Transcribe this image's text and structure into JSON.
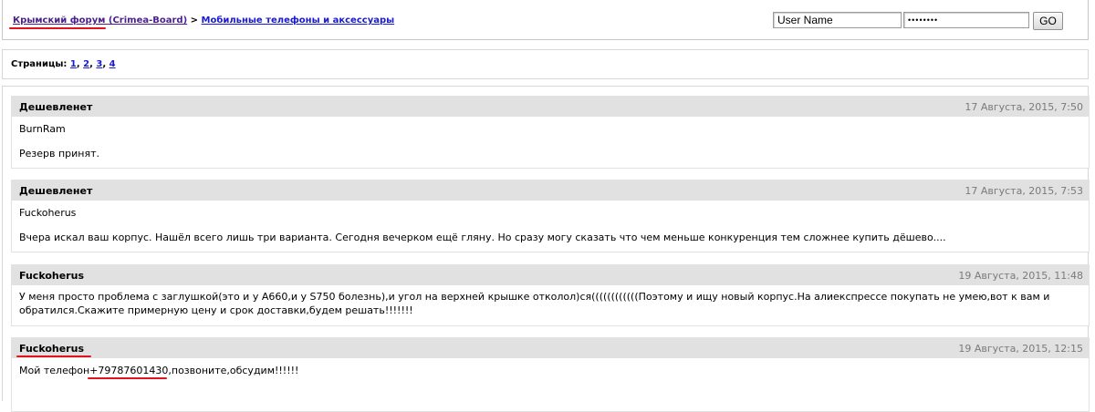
{
  "header": {
    "breadcrumb_forum": "Крымский форум (Crimea-Board)",
    "breadcrumb_sep": ">",
    "breadcrumb_category": "Мобильные телефоны и аксессуары",
    "username_value": "User Name",
    "password_value": "••••••••",
    "go_label": "GO"
  },
  "pagination": {
    "label": "Страницы:",
    "pages": [
      "1",
      "2",
      "3",
      "4"
    ]
  },
  "posts": [
    {
      "author": "Дешевленет",
      "date": "17 Августа, 2015, 7:50",
      "quote_name": "BurnRam",
      "text": "Резерв принят."
    },
    {
      "author": "Дешевленет",
      "date": "17 Августа, 2015, 7:53",
      "quote_name": "Fuckoherus",
      "text": "Вчера искал ваш корпус. Нашёл всего лишь три варианта. Сегодня вечерком ещё гляну. Но сразу могу сказать что чем меньше конкуренция тем сложнее купить дёшево...."
    },
    {
      "author": "Fuckoherus",
      "date": "19 Августа, 2015, 11:48",
      "text": "У меня просто проблема с заглушкой(это и у A660,и у S750 болезнь),и угол на верхней крышке отколол)ся((((((((((((Поэтому и ищу новый корпус.На алиекспрессе покупать не умею,вот к вам и обратился.Скажите примерную цену и срок доставки,будем решать!!!!!!!"
    },
    {
      "author": "Fuckoherus",
      "date": "19 Августа, 2015, 12:15",
      "text_before": "Мой телефон",
      "phone": "+79787601430",
      "text_after": ",позвоните,обсудим!!!!!!"
    }
  ],
  "colors": {
    "annotation_underline": "#e0141e",
    "header_bg": "#e1e1e1"
  }
}
